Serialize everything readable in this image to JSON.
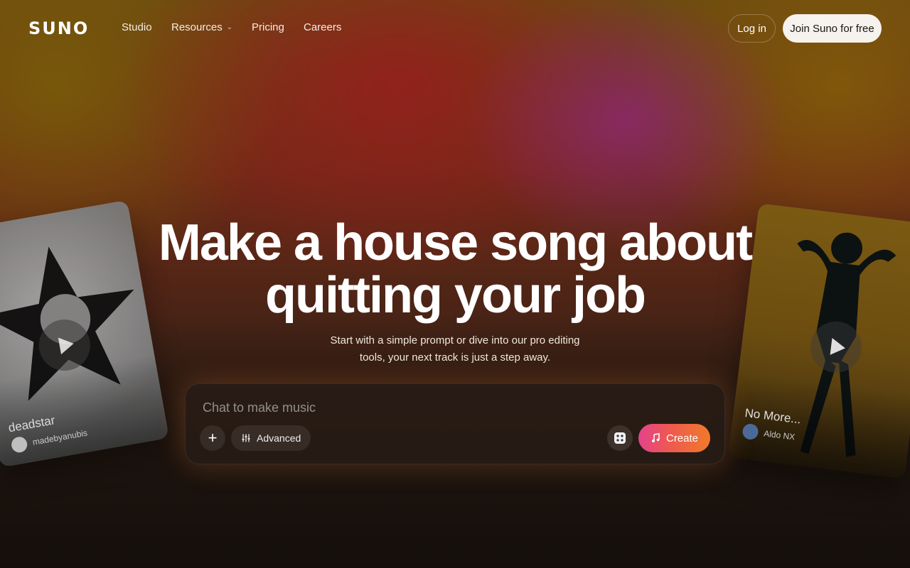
{
  "nav": {
    "logo": "SUNO",
    "links": [
      "Studio",
      "Resources",
      "Pricing",
      "Careers"
    ],
    "login": "Log in",
    "join": "Join Suno for free"
  },
  "hero": {
    "title_line1": "Make a house song about",
    "title_line2": "quitting your job",
    "subtitle_line1": "Start with a simple prompt or dive into our pro editing",
    "subtitle_line2": "tools, your next track is just a step away."
  },
  "prompt": {
    "placeholder": "Chat to make music",
    "plus": "+",
    "advanced": "Advanced",
    "create": "Create"
  },
  "cards": {
    "left": {
      "title": "deadstar",
      "user": "madebyanubis"
    },
    "right": {
      "title": "No More...",
      "user": "Aldo NX"
    }
  },
  "icons": {
    "dropdown": "chevron-down-icon",
    "plus": "plus-icon",
    "advanced": "sliders-icon",
    "dice": "dice-icon",
    "create": "music-note-icon",
    "play": "play-icon"
  },
  "colors": {
    "create_gradient_start": "#e4428c",
    "create_gradient_end": "#f07a2a",
    "join_button_bg": "#f6f2ee"
  }
}
